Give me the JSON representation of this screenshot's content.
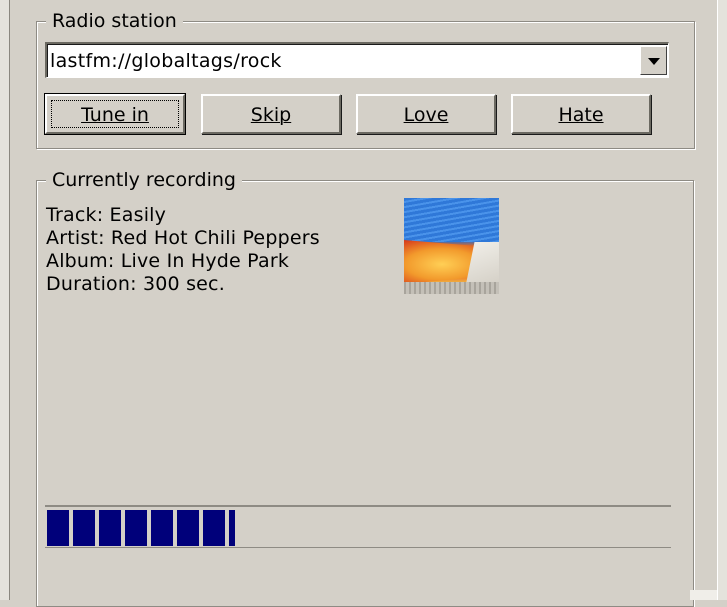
{
  "radio_group": {
    "title": "Radio station",
    "station_url": "lastfm://globaltags/rock"
  },
  "buttons": {
    "tune_in": "Tune in",
    "skip": "Skip",
    "love": "Love",
    "hate": "Hate"
  },
  "recording_group": {
    "title": "Currently recording",
    "track": "Track: Easily",
    "artist": "Artist: Red Hot Chili Peppers",
    "album": "Album: Live In Hyde Park",
    "duration": "Duration: 300 sec."
  },
  "progress": {
    "fraction": 0.3
  },
  "colors": {
    "window_bg": "#d4d0c8",
    "progress_fill": "#00007a"
  },
  "icons": {
    "combo_arrow": "chevron-down-icon",
    "album_art": "album-cover"
  }
}
